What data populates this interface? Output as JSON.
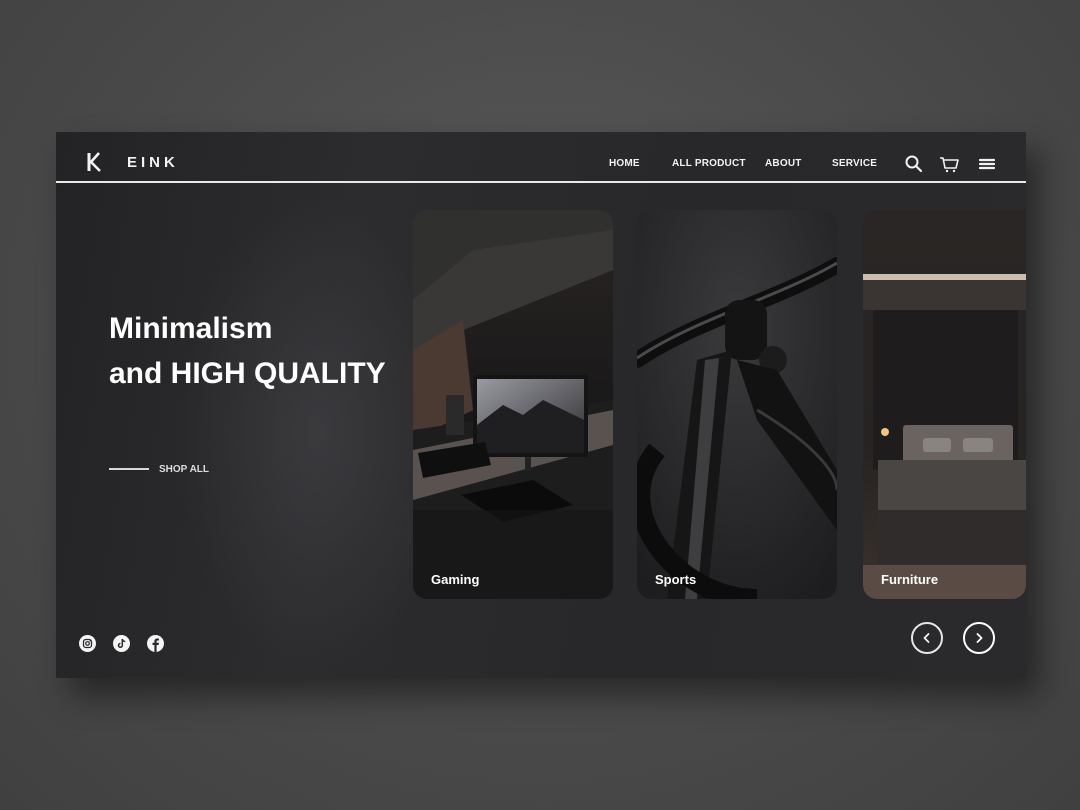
{
  "header": {
    "brand": "EINK",
    "nav": [
      "HOME",
      "ALL PRODUCT",
      "ABOUT",
      "SERVICE"
    ],
    "icons": [
      "search-icon",
      "cart-icon",
      "menu-icon"
    ]
  },
  "hero": {
    "line1": "Minimalism",
    "line2": "and HIGH QUALITY",
    "cta": "SHOP ALL"
  },
  "cards": [
    {
      "label": "Gaming"
    },
    {
      "label": "Sports"
    },
    {
      "label": "Furniture"
    }
  ],
  "social": [
    "instagram-icon",
    "tiktok-icon",
    "facebook-icon"
  ],
  "colors": {
    "panel": "#2a2a2d",
    "backdrop": "#4a4a4a",
    "text": "#ffffff",
    "rule": "#e9e9e9"
  }
}
